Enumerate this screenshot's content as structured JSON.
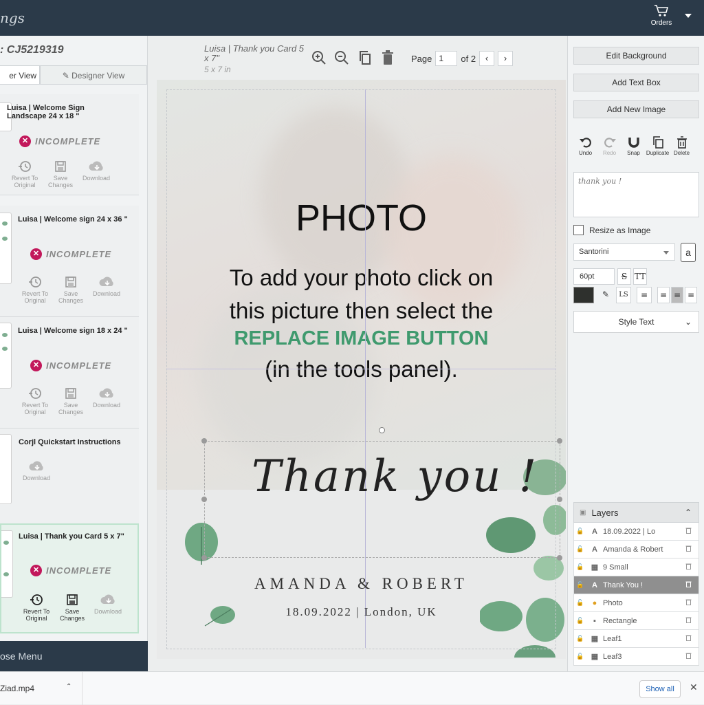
{
  "app": {
    "logo_text": "ngs",
    "orders_label": "Orders"
  },
  "left": {
    "order_id": ": CJ5219319",
    "tab_user": "er View",
    "tab_designer": "Designer View",
    "cards": [
      {
        "title": "Luisa | Welcome Sign Landscape 24 x 18 \"",
        "status": "INCOMPLETE",
        "actions": [
          "Revert To Original",
          "Save Changes",
          "Download"
        ]
      },
      {
        "title": "Luisa | Welcome sign 24 x 36 \"",
        "status": "INCOMPLETE",
        "actions": [
          "Revert To Original",
          "Save Changes",
          "Download"
        ]
      },
      {
        "title": "Luisa | Welcome sign 18 x 24 \"",
        "status": "INCOMPLETE",
        "actions": [
          "Revert To Original",
          "Save Changes",
          "Download"
        ]
      },
      {
        "title": "Corjl Quickstart Instructions",
        "actions": [
          "Download"
        ]
      },
      {
        "title": "Luisa | Thank you Card 5 x 7\"",
        "status": "INCOMPLETE",
        "actions": [
          "Revert To Original",
          "Save Changes",
          "Download"
        ]
      }
    ],
    "close_menu": "ose Menu"
  },
  "canvas": {
    "doc_title": "Luisa | Thank you Card 5 x 7\"",
    "doc_size": "5 x 7 in",
    "page_label": "Page",
    "page_value": "1",
    "page_of": "of 2",
    "photo_title": "PHOTO",
    "photo_line1": "To add your photo click on",
    "photo_line2": "this picture then select the",
    "photo_line3": "REPLACE IMAGE BUTTON",
    "photo_line4": "(in the tools panel).",
    "thanks_text": "Thank you !",
    "names_text": "AMANDA & ROBERT",
    "date_text": "18.09.2022 | London, UK",
    "accent_green": "#3f9a6e"
  },
  "right": {
    "edit_background": "Edit Background",
    "add_text_box": "Add Text Box",
    "add_new_image": "Add New Image",
    "tools": [
      "Undo",
      "Redo",
      "Snap",
      "Duplicate",
      "Delete"
    ],
    "text_value": "thank you !",
    "resize_label": "Resize as Image",
    "font": "Santorini",
    "font_size": "60pt",
    "style_text": "Style Text",
    "text_color": "#2e302d",
    "layers_title": "Layers",
    "layers": [
      {
        "name": "18.09.2022 | Lo",
        "type": "A"
      },
      {
        "name": "Amanda & Robert",
        "type": "A"
      },
      {
        "name": "9 Small",
        "type": "img"
      },
      {
        "name": "Thank You !",
        "type": "A",
        "selected": true
      },
      {
        "name": "Photo",
        "type": "photo"
      },
      {
        "name": "Rectangle",
        "type": "shape"
      },
      {
        "name": "Leaf1",
        "type": "img"
      },
      {
        "name": "Leaf3",
        "type": "img"
      }
    ]
  },
  "downloads": {
    "file": "Ziad.mp4",
    "show_all": "Show all"
  }
}
